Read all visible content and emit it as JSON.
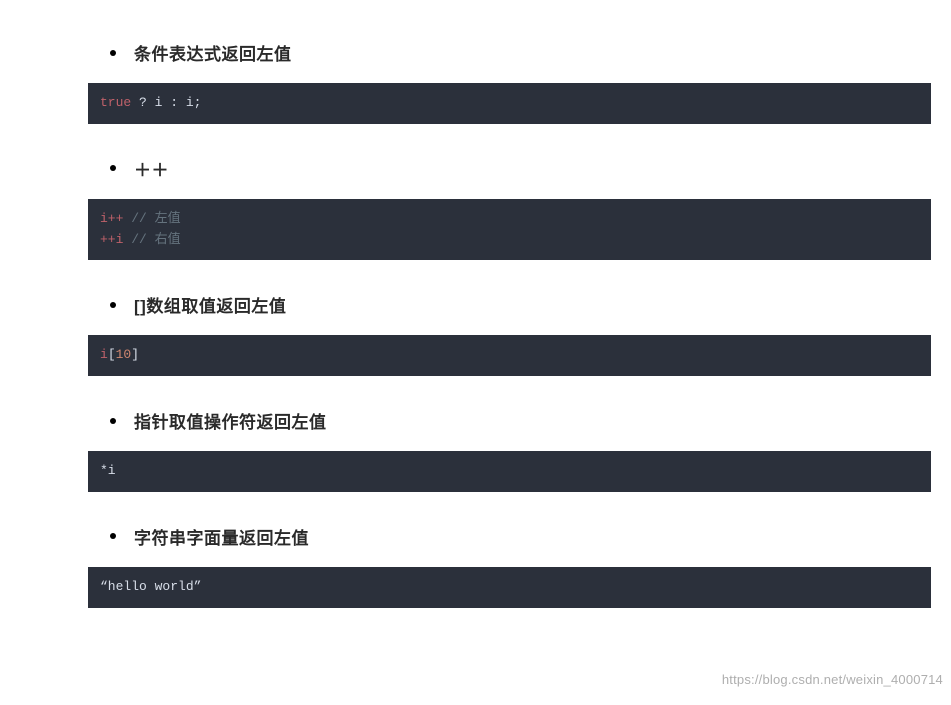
{
  "sections": [
    {
      "heading": "条件表达式返回左值",
      "code_html": "<span class='keyword'>true</span> ? i : i;"
    },
    {
      "heading": "＋＋",
      "code_html": "<span class='keyword'>i++</span> <span class='comment'>// 左值</span>\n<span class='keyword'>++i</span> <span class='comment'>// 右值</span>"
    },
    {
      "heading": "[]数组取值返回左值",
      "code_html": "<span class='keyword'>i</span>[<span class='number'>10</span>]"
    },
    {
      "heading": "指针取值操作符返回左值",
      "code_html": "*i"
    },
    {
      "heading": "字符串字面量返回左值",
      "code_html": "<span class='string'>“hello world”</span>"
    }
  ],
  "watermark": "https://blog.csdn.net/weixin_4000714"
}
